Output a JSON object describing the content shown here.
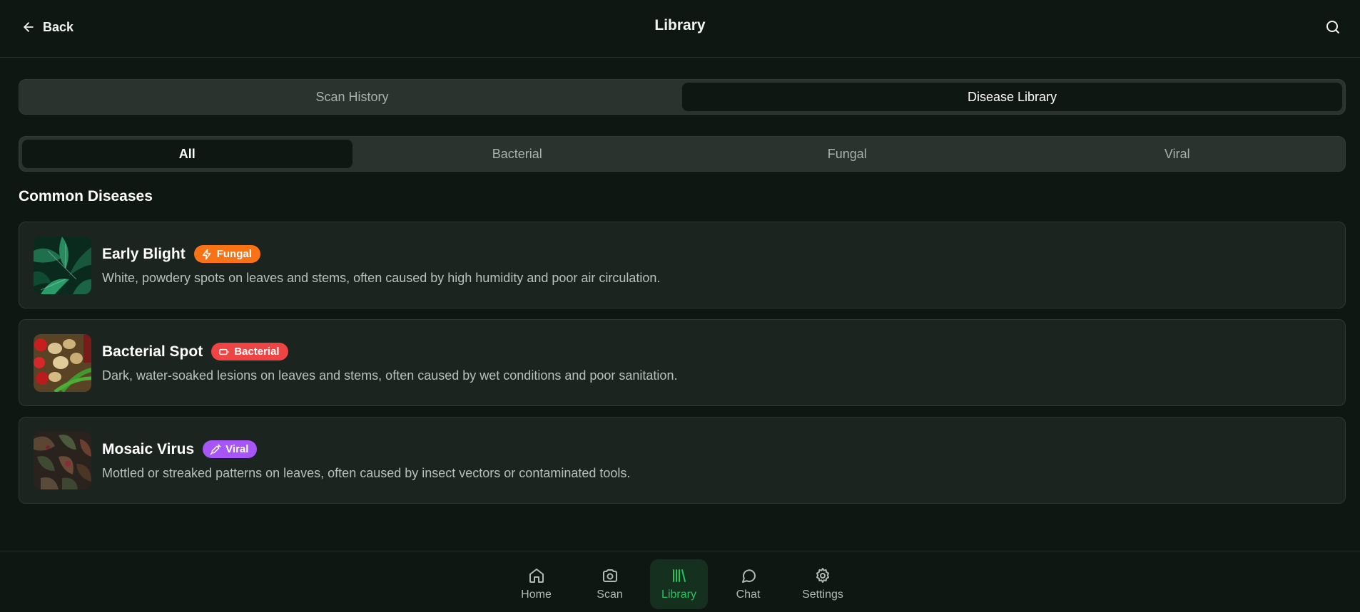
{
  "header": {
    "back_label": "Back",
    "title": "Library",
    "back_icon": "arrow-left-icon",
    "search_icon": "search-icon"
  },
  "main_tabs": [
    {
      "label": "Scan History",
      "active": false
    },
    {
      "label": "Disease Library",
      "active": true
    }
  ],
  "filter_tabs": [
    {
      "label": "All",
      "active": true
    },
    {
      "label": "Bacterial",
      "active": false
    },
    {
      "label": "Fungal",
      "active": false
    },
    {
      "label": "Viral",
      "active": false
    }
  ],
  "section_title": "Common Diseases",
  "diseases": [
    {
      "name": "Early Blight",
      "badge": "Fungal",
      "badge_icon": "lightning-icon",
      "badge_color": "#f97316",
      "description": "White, powdery spots on leaves and stems, often caused by high humidity and poor air circulation."
    },
    {
      "name": "Bacterial Spot",
      "badge": "Bacterial",
      "badge_icon": "battery-icon",
      "badge_color": "#ef4444",
      "description": "Dark, water-soaked lesions on leaves and stems, often caused by wet conditions and poor sanitation."
    },
    {
      "name": "Mosaic Virus",
      "badge": "Viral",
      "badge_icon": "syringe-icon",
      "badge_color": "#a855f7",
      "description": "Mottled or streaked patterns on leaves, often caused by insect vectors or contaminated tools."
    }
  ],
  "nav": [
    {
      "label": "Home",
      "icon": "home-icon",
      "active": false
    },
    {
      "label": "Scan",
      "icon": "camera-icon",
      "active": false
    },
    {
      "label": "Library",
      "icon": "library-icon",
      "active": true
    },
    {
      "label": "Chat",
      "icon": "chat-bubble-icon",
      "active": false
    },
    {
      "label": "Settings",
      "icon": "gear-icon",
      "active": false
    }
  ],
  "colors": {
    "background": "#0f1713",
    "card": "#1c2420",
    "accent": "#22c55e"
  }
}
